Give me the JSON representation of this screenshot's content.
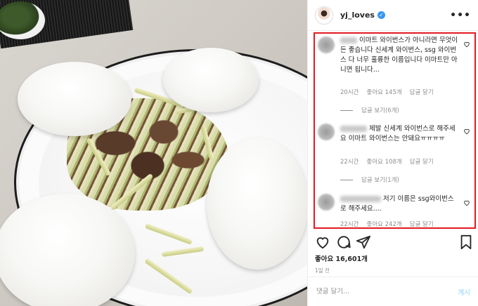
{
  "post": {
    "username": "yj_loves",
    "verified_mark": "✓",
    "more_label": "•••"
  },
  "comments": [
    {
      "text": "이마트 와이번스가 아니라면 무엇이든 좋습니다 신세계 와이번스, ssg 와이번스 다 너무 훌륭한 이름입니다 이마트만 아니면 됩니다...",
      "time": "20시간",
      "likes": "좋아요 145개",
      "reply": "답글 달기",
      "view_replies": "답글 보기(6개)"
    },
    {
      "text": "제발 신세계 와이번스로 해주세요 이마트 와이번스는 안돼요ㅠㅠㅠㅠ",
      "time": "22시간",
      "likes": "좋아요 108개",
      "reply": "답글 달기",
      "view_replies": "답글 보기(1개)"
    },
    {
      "text": "저기 이름은 ssg와이번스로 해주세요....",
      "time": "22시간",
      "likes": "좋아요 242개",
      "reply": "답글 달기"
    }
  ],
  "likes_label": "좋아요 16,601개",
  "time_ago": "1일 전",
  "comment_input": {
    "placeholder": "댓글 달기...",
    "post_label": "게시"
  },
  "colors": {
    "highlight_border": "#e21a22",
    "verified": "#3897f0",
    "post_button": "#b2dffc"
  },
  "icons": [
    "heart-icon",
    "comment-icon",
    "share-icon",
    "bookmark-icon",
    "more-icon",
    "verified-icon"
  ]
}
